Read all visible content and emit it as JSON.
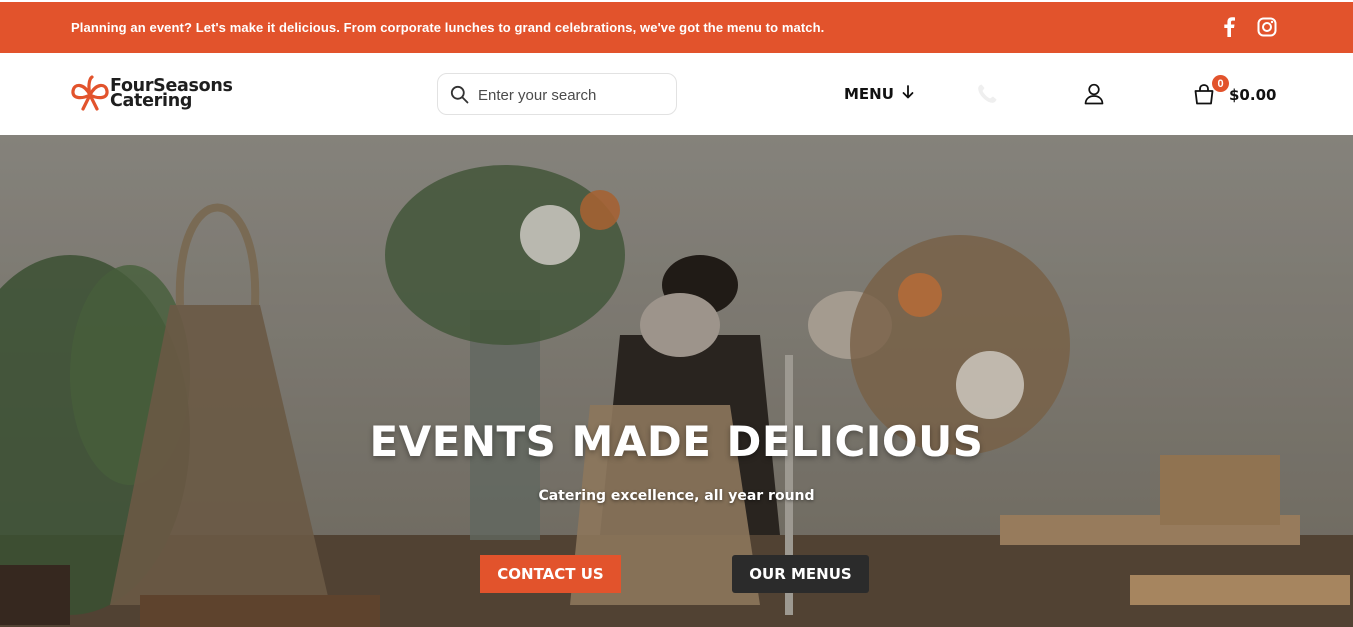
{
  "topbar": {
    "announcement": "Planning an event? Let's make it delicious. From corporate lunches to grand celebrations, we've got the menu to match.",
    "social": [
      "facebook-icon",
      "instagram-icon"
    ]
  },
  "header": {
    "logo": {
      "line1": "FourSeasons",
      "line2": "Catering",
      "mark_icon": "bow-ribbon-icon"
    },
    "search": {
      "placeholder": "Enter your search",
      "value": ""
    },
    "menu_label": "MENU",
    "cart": {
      "count": "0",
      "total": "$0.00"
    }
  },
  "hero": {
    "title": "EVENTS MADE DELICIOUS",
    "subtitle": "Catering excellence, all year round",
    "buttons": {
      "contact": "CONTACT US",
      "menus": "OUR MENUS"
    }
  },
  "colors": {
    "accent": "#e2532c",
    "dark_button": "#2b2b2b",
    "text": "#111111"
  }
}
